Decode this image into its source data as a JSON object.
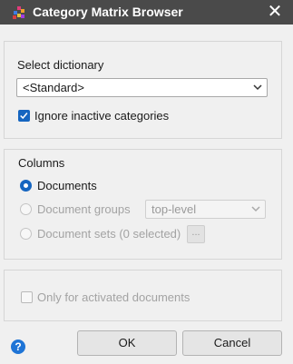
{
  "window": {
    "title": "Category Matrix Browser",
    "close_glyph": "✕",
    "icon": "app-matrix-icon"
  },
  "dictionary": {
    "label": "Select dictionary",
    "selected": "<Standard>",
    "ignore_inactive": {
      "label": "Ignore inactive categories",
      "checked": true
    }
  },
  "columns": {
    "legend": "Columns",
    "options": [
      {
        "label": "Documents",
        "selected": true,
        "enabled": true
      },
      {
        "label": "Document groups",
        "selected": false,
        "enabled": false
      },
      {
        "label": "Document sets (0 selected)",
        "selected": false,
        "enabled": false
      }
    ],
    "groups_level": "top-level",
    "sets_button": "..."
  },
  "filter": {
    "only_activated": {
      "label": "Only for activated documents",
      "checked": false,
      "enabled": false
    }
  },
  "footer": {
    "help_glyph": "?",
    "ok_label": "OK",
    "cancel_label": "Cancel"
  },
  "colors": {
    "accent": "#1565c0",
    "titlebar": "#4a4a4a",
    "help": "#1e74d6"
  }
}
